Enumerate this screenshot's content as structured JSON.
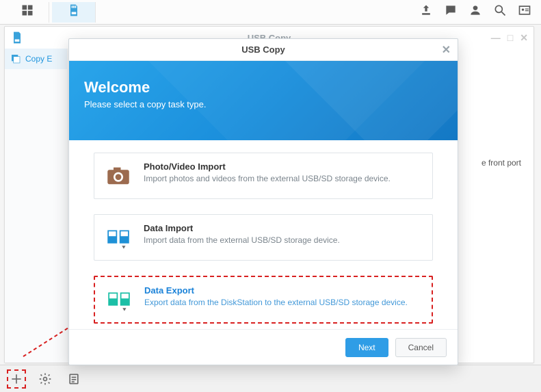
{
  "system_toolbar": {
    "icons": [
      "apps",
      "sd-card"
    ],
    "right_icons": [
      "upload",
      "chat",
      "user",
      "search",
      "id-card"
    ]
  },
  "app": {
    "title": "USB Copy",
    "win_controls": [
      "—",
      "□",
      "✕"
    ],
    "sidebar": {
      "items": [
        {
          "label": "Copy E"
        }
      ]
    },
    "content_hint": "e front port"
  },
  "bottom_bar": {
    "buttons": [
      "add",
      "settings",
      "list"
    ]
  },
  "dialog": {
    "title": "USB Copy",
    "hero": {
      "heading": "Welcome",
      "sub": "Please select a copy task type."
    },
    "choices": [
      {
        "key": "photo-video-import",
        "title": "Photo/Video Import",
        "desc": "Import photos and videos from the external USB/SD storage device.",
        "icon": "camera",
        "selected": false
      },
      {
        "key": "data-import",
        "title": "Data Import",
        "desc": "Import data from the external USB/SD storage device.",
        "icon": "drives-in",
        "selected": false
      },
      {
        "key": "data-export",
        "title": "Data Export",
        "desc": "Export data from the DiskStation to the external USB/SD storage device.",
        "icon": "drives-out",
        "selected": true
      }
    ],
    "footer": {
      "primary": "Next",
      "secondary": "Cancel"
    }
  }
}
